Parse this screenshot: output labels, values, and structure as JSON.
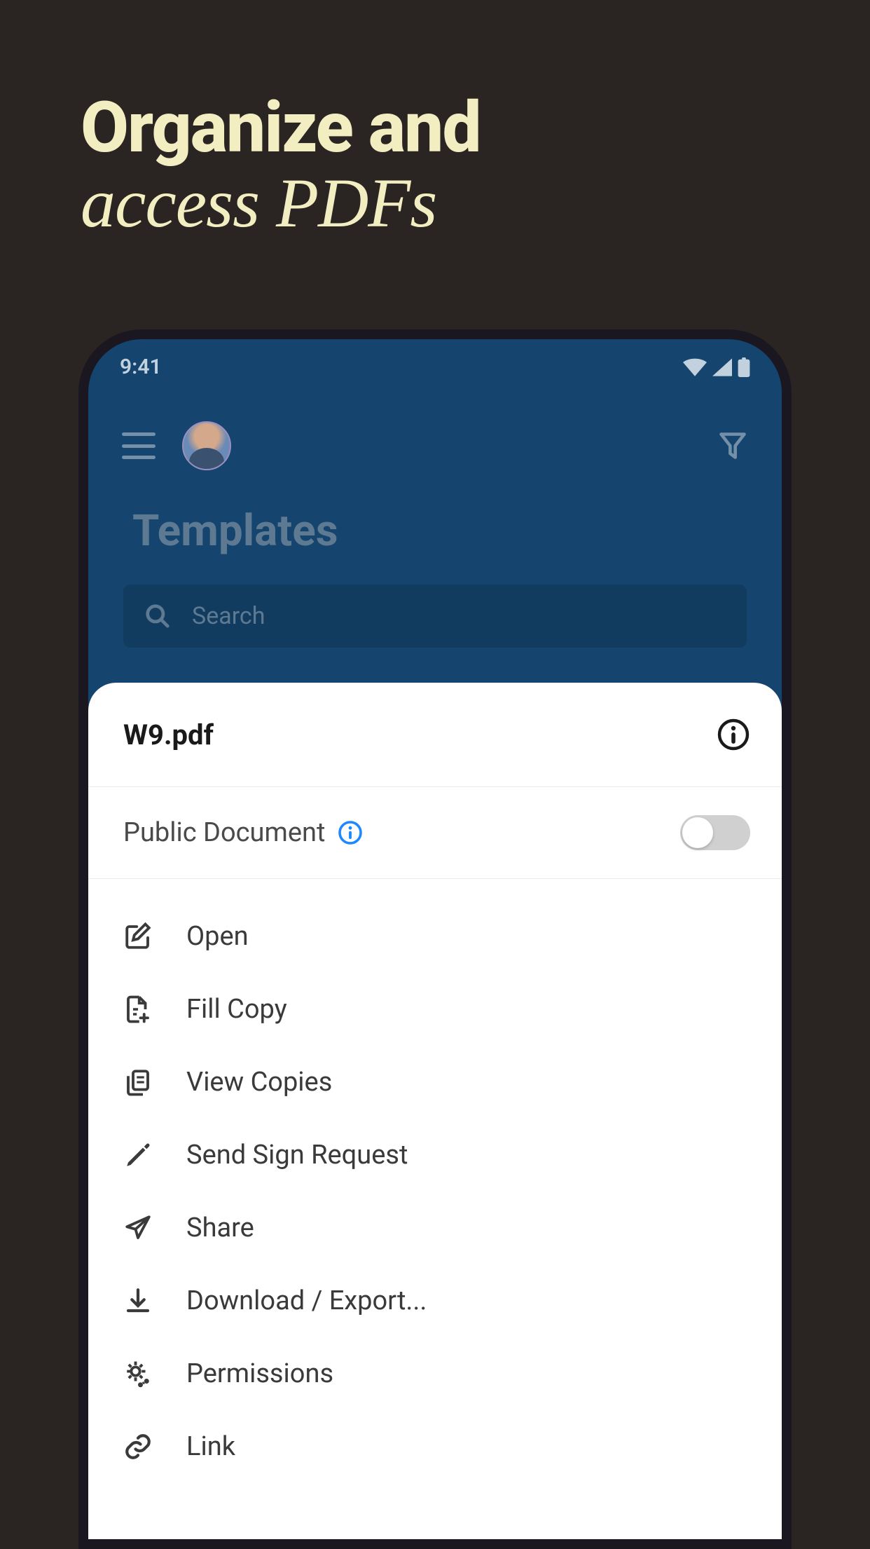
{
  "hero": {
    "line1": "Organize and",
    "line2": "access PDFs"
  },
  "status": {
    "time": "9:41"
  },
  "header": {
    "page_title": "Templates"
  },
  "search": {
    "placeholder": "Search"
  },
  "sheet": {
    "title": "W9.pdf",
    "public_label": "Public Document",
    "public_enabled": false,
    "items": [
      {
        "icon": "edit-square-icon",
        "label": "Open"
      },
      {
        "icon": "file-plus-icon",
        "label": "Fill Copy"
      },
      {
        "icon": "copies-icon",
        "label": "View Copies"
      },
      {
        "icon": "pen-nib-icon",
        "label": "Send Sign Request"
      },
      {
        "icon": "paper-plane-icon",
        "label": "Share"
      },
      {
        "icon": "download-icon",
        "label": "Download / Export..."
      },
      {
        "icon": "gear-share-icon",
        "label": "Permissions"
      },
      {
        "icon": "link-icon",
        "label": "Link"
      }
    ]
  },
  "colors": {
    "bg": "#2a2422",
    "hero_text": "#f3eec2",
    "phone_bg": "#15446e",
    "sheet_bg": "#ffffff",
    "info_blue": "#1e88ff"
  }
}
